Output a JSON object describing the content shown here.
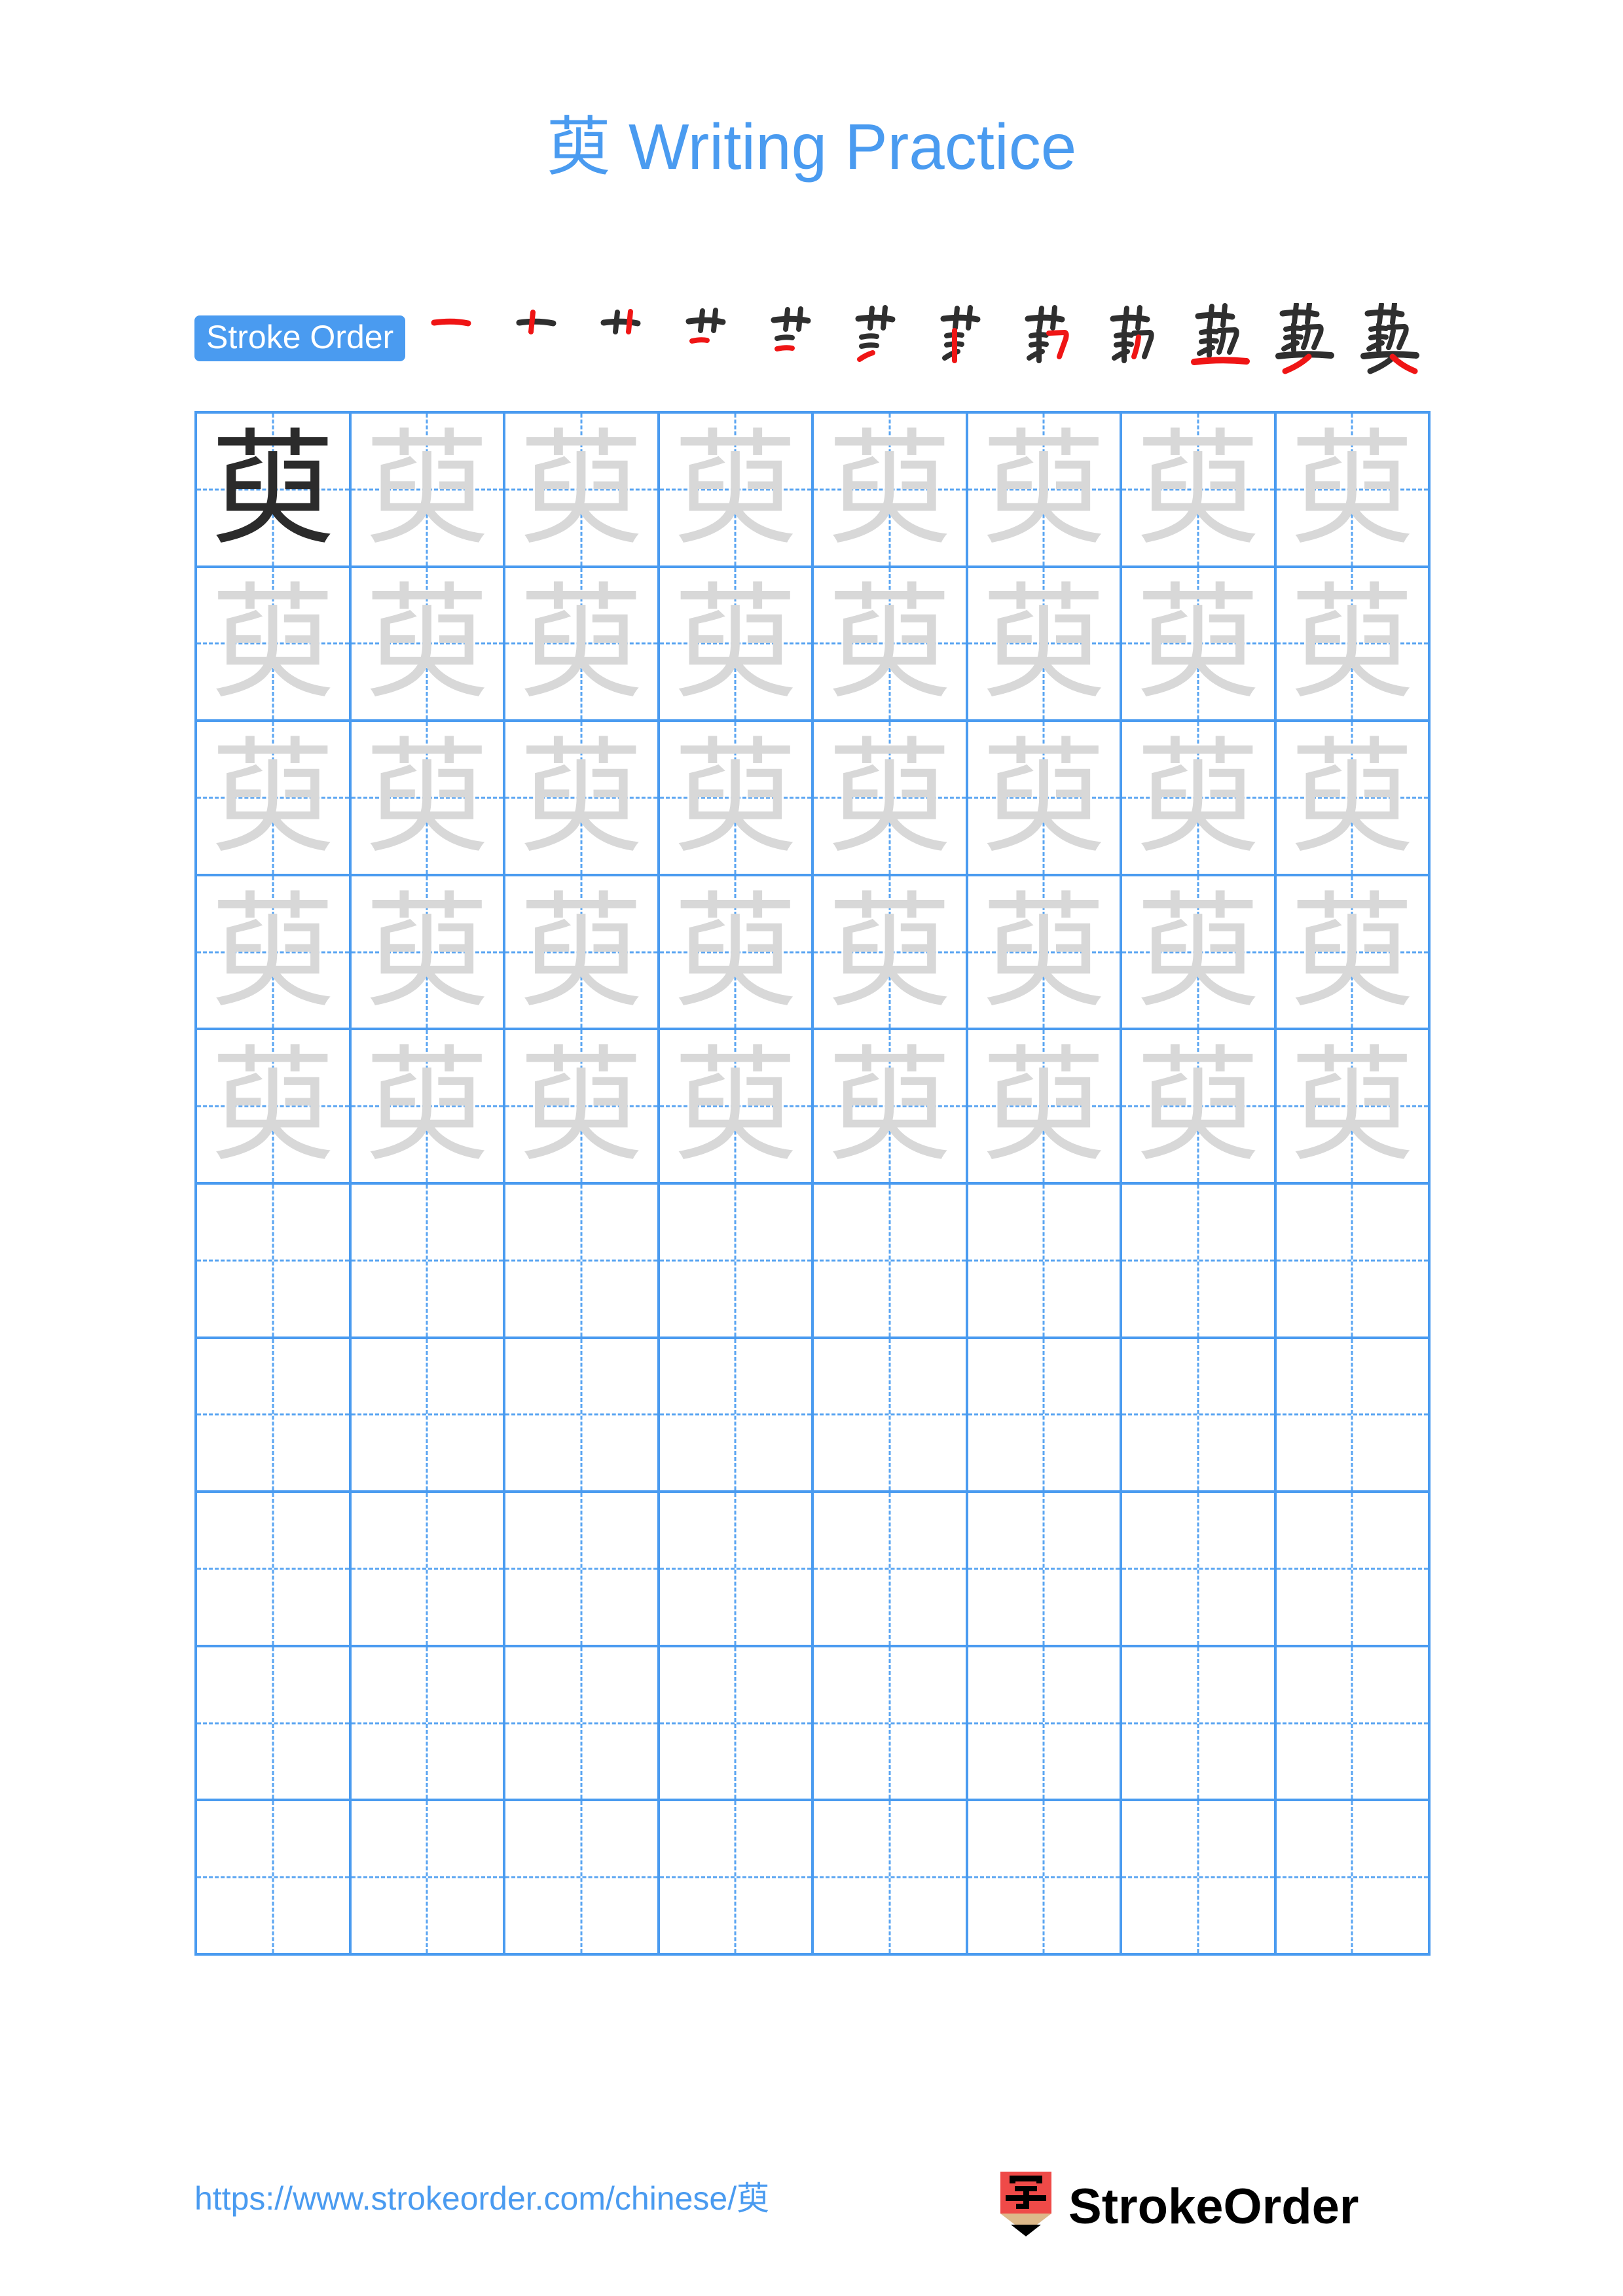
{
  "page": {
    "character": "萸",
    "title_suffix": "Writing Practice",
    "background_color": "#ffffff",
    "accent_color": "#4a9bf0"
  },
  "header": {
    "title_character": "萸",
    "title_text": "Writing Practice"
  },
  "stroke_order": {
    "badge_label": "Stroke Order",
    "badge_bg_color": "#4a9bf0",
    "badge_text_color": "#ffffff",
    "total_steps": 12,
    "done_stroke_color": "#2f2f2f",
    "new_stroke_color": "#ef1515",
    "steps": [
      {
        "index": 1,
        "new_stroke": "heng",
        "strokes_shown": 1
      },
      {
        "index": 2,
        "new_stroke": "shu",
        "strokes_shown": 2
      },
      {
        "index": 3,
        "new_stroke": "shu",
        "strokes_shown": 3
      },
      {
        "index": 4,
        "new_stroke": "heng",
        "strokes_shown": 4
      },
      {
        "index": 5,
        "new_stroke": "heng",
        "strokes_shown": 5
      },
      {
        "index": 6,
        "new_stroke": "pie",
        "strokes_shown": 6
      },
      {
        "index": 7,
        "new_stroke": "shu",
        "strokes_shown": 7
      },
      {
        "index": 8,
        "new_stroke": "hengzhegou",
        "strokes_shown": 8
      },
      {
        "index": 9,
        "new_stroke": "shu",
        "strokes_shown": 9
      },
      {
        "index": 10,
        "new_stroke": "heng",
        "strokes_shown": 10
      },
      {
        "index": 11,
        "new_stroke": "pie",
        "strokes_shown": 11
      },
      {
        "index": 12,
        "new_stroke": "na",
        "strokes_shown": 12
      }
    ]
  },
  "practice_grid": {
    "rows": 10,
    "columns": 8,
    "grid_line_color": "#4a9bf0",
    "guide_line_color": "#5aa5f2",
    "dark_char_color": "#2b2b2b",
    "trace_char_color": "#d8d8d8",
    "filled_rows": 5,
    "empty_rows": 5,
    "cells": [
      [
        "dark",
        "trace",
        "trace",
        "trace",
        "trace",
        "trace",
        "trace",
        "trace"
      ],
      [
        "trace",
        "trace",
        "trace",
        "trace",
        "trace",
        "trace",
        "trace",
        "trace"
      ],
      [
        "trace",
        "trace",
        "trace",
        "trace",
        "trace",
        "trace",
        "trace",
        "trace"
      ],
      [
        "trace",
        "trace",
        "trace",
        "trace",
        "trace",
        "trace",
        "trace",
        "trace"
      ],
      [
        "trace",
        "trace",
        "trace",
        "trace",
        "trace",
        "trace",
        "trace",
        "trace"
      ],
      [
        "blank",
        "blank",
        "blank",
        "blank",
        "blank",
        "blank",
        "blank",
        "blank"
      ],
      [
        "blank",
        "blank",
        "blank",
        "blank",
        "blank",
        "blank",
        "blank",
        "blank"
      ],
      [
        "blank",
        "blank",
        "blank",
        "blank",
        "blank",
        "blank",
        "blank",
        "blank"
      ],
      [
        "blank",
        "blank",
        "blank",
        "blank",
        "blank",
        "blank",
        "blank",
        "blank"
      ],
      [
        "blank",
        "blank",
        "blank",
        "blank",
        "blank",
        "blank",
        "blank",
        "blank"
      ]
    ]
  },
  "footer": {
    "url_prefix": "https://www.strokeorder.com/chinese/",
    "url_character": "萸",
    "logo_text": "StrokeOrder",
    "logo_char": "字",
    "logo_body_color": "#ef4a48",
    "logo_wood_color": "#ddb98a",
    "logo_tip_color": "#000000"
  }
}
